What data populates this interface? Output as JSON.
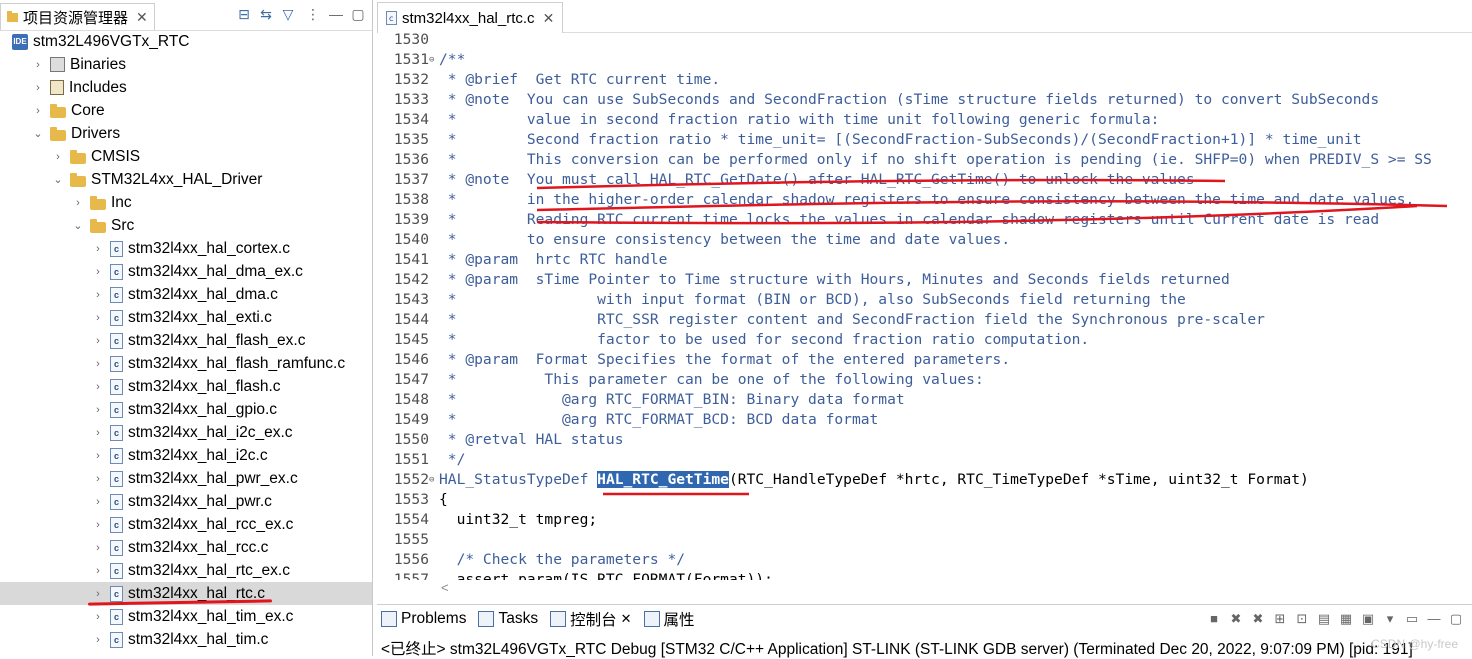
{
  "left_panel": {
    "tab_title": "项目资源管理器",
    "tree": [
      {
        "label": "stm32L496VGTx_RTC",
        "icon": "project-icon",
        "level": 0,
        "chevron": "down"
      },
      {
        "label": "Binaries",
        "icon": "binaries-icon",
        "level": 1,
        "chevron": "right"
      },
      {
        "label": "Includes",
        "icon": "includes-icon",
        "level": 1,
        "chevron": "right"
      },
      {
        "label": "Core",
        "icon": "folder-icon",
        "level": 1,
        "chevron": "right"
      },
      {
        "label": "Drivers",
        "icon": "folder-icon",
        "level": 1,
        "chevron": "down"
      },
      {
        "label": "CMSIS",
        "icon": "folder-icon",
        "level": 2,
        "chevron": "right"
      },
      {
        "label": "STM32L4xx_HAL_Driver",
        "icon": "folder-icon",
        "level": 2,
        "chevron": "down"
      },
      {
        "label": "Inc",
        "icon": "folder-icon",
        "level": 3,
        "chevron": "right"
      },
      {
        "label": "Src",
        "icon": "folder-icon",
        "level": 3,
        "chevron": "down"
      },
      {
        "label": "stm32l4xx_hal_cortex.c",
        "icon": "c-file-icon",
        "level": 4,
        "chevron": "right"
      },
      {
        "label": "stm32l4xx_hal_dma_ex.c",
        "icon": "c-file-icon",
        "level": 4,
        "chevron": "right"
      },
      {
        "label": "stm32l4xx_hal_dma.c",
        "icon": "c-file-icon",
        "level": 4,
        "chevron": "right"
      },
      {
        "label": "stm32l4xx_hal_exti.c",
        "icon": "c-file-icon",
        "level": 4,
        "chevron": "right"
      },
      {
        "label": "stm32l4xx_hal_flash_ex.c",
        "icon": "c-file-icon",
        "level": 4,
        "chevron": "right"
      },
      {
        "label": "stm32l4xx_hal_flash_ramfunc.c",
        "icon": "c-file-icon",
        "level": 4,
        "chevron": "right"
      },
      {
        "label": "stm32l4xx_hal_flash.c",
        "icon": "c-file-icon",
        "level": 4,
        "chevron": "right"
      },
      {
        "label": "stm32l4xx_hal_gpio.c",
        "icon": "c-file-icon",
        "level": 4,
        "chevron": "right"
      },
      {
        "label": "stm32l4xx_hal_i2c_ex.c",
        "icon": "c-file-icon",
        "level": 4,
        "chevron": "right"
      },
      {
        "label": "stm32l4xx_hal_i2c.c",
        "icon": "c-file-icon",
        "level": 4,
        "chevron": "right"
      },
      {
        "label": "stm32l4xx_hal_pwr_ex.c",
        "icon": "c-file-icon",
        "level": 4,
        "chevron": "right"
      },
      {
        "label": "stm32l4xx_hal_pwr.c",
        "icon": "c-file-icon",
        "level": 4,
        "chevron": "right"
      },
      {
        "label": "stm32l4xx_hal_rcc_ex.c",
        "icon": "c-file-icon",
        "level": 4,
        "chevron": "right"
      },
      {
        "label": "stm32l4xx_hal_rcc.c",
        "icon": "c-file-icon",
        "level": 4,
        "chevron": "right"
      },
      {
        "label": "stm32l4xx_hal_rtc_ex.c",
        "icon": "c-file-icon",
        "level": 4,
        "chevron": "right"
      },
      {
        "label": "stm32l4xx_hal_rtc.c",
        "icon": "c-file-icon",
        "level": 4,
        "chevron": "right",
        "selected": true
      },
      {
        "label": "stm32l4xx_hal_tim_ex.c",
        "icon": "c-file-icon",
        "level": 4,
        "chevron": "right"
      },
      {
        "label": "stm32l4xx_hal_tim.c",
        "icon": "c-file-icon",
        "level": 4,
        "chevron": "right"
      }
    ]
  },
  "editor": {
    "tab_title": "stm32l4xx_hal_rtc.c",
    "lines": [
      {
        "n": "1530",
        "t": "",
        "kind": "comment"
      },
      {
        "n": "1531",
        "t": "/**",
        "kind": "comment",
        "fold": true
      },
      {
        "n": "1532",
        "t": " * @brief  Get RTC current time.",
        "kind": "comment"
      },
      {
        "n": "1533",
        "t": " * @note  You can use SubSeconds and SecondFraction (sTime structure fields returned) to convert SubSeconds",
        "kind": "comment"
      },
      {
        "n": "1534",
        "t": " *        value in second fraction ratio with time unit following generic formula:",
        "kind": "comment"
      },
      {
        "n": "1535",
        "t": " *        Second fraction ratio * time_unit= [(SecondFraction-SubSeconds)/(SecondFraction+1)] * time_unit",
        "kind": "comment"
      },
      {
        "n": "1536",
        "t": " *        This conversion can be performed only if no shift operation is pending (ie. SHFP=0) when PREDIV_S >= SS",
        "kind": "comment"
      },
      {
        "n": "1537",
        "t": " * @note  You must call HAL_RTC_GetDate() after HAL_RTC_GetTime() to unlock the values",
        "kind": "comment"
      },
      {
        "n": "1538",
        "t": " *        in the higher-order calendar shadow registers to ensure consistency between the time and date values.",
        "kind": "comment"
      },
      {
        "n": "1539",
        "t": " *        Reading RTC current time locks the values in calendar shadow registers until Current date is read",
        "kind": "comment"
      },
      {
        "n": "1540",
        "t": " *        to ensure consistency between the time and date values.",
        "kind": "comment"
      },
      {
        "n": "1541",
        "t": " * @param  hrtc RTC handle",
        "kind": "comment"
      },
      {
        "n": "1542",
        "t": " * @param  sTime Pointer to Time structure with Hours, Minutes and Seconds fields returned",
        "kind": "comment"
      },
      {
        "n": "1543",
        "t": " *                with input format (BIN or BCD), also SubSeconds field returning the",
        "kind": "comment"
      },
      {
        "n": "1544",
        "t": " *                RTC_SSR register content and SecondFraction field the Synchronous pre-scaler",
        "kind": "comment"
      },
      {
        "n": "1545",
        "t": " *                factor to be used for second fraction ratio computation.",
        "kind": "comment"
      },
      {
        "n": "1546",
        "t": " * @param  Format Specifies the format of the entered parameters.",
        "kind": "comment"
      },
      {
        "n": "1547",
        "t": " *          This parameter can be one of the following values:",
        "kind": "comment"
      },
      {
        "n": "1548",
        "t": " *            @arg RTC_FORMAT_BIN: Binary data format",
        "kind": "comment"
      },
      {
        "n": "1549",
        "t": " *            @arg RTC_FORMAT_BCD: BCD data format",
        "kind": "comment"
      },
      {
        "n": "1550",
        "t": " * @retval HAL status",
        "kind": "comment"
      },
      {
        "n": "1551",
        "t": " */",
        "kind": "comment"
      },
      {
        "n": "1552",
        "t_pre": "HAL_StatusTypeDef ",
        "t_sel": "HAL_RTC_GetTime",
        "t_post": "(RTC_HandleTypeDef *hrtc, RTC_TimeTypeDef *sTime, uint32_t Format)",
        "kind": "signature",
        "fold": true
      },
      {
        "n": "1553",
        "t": "{",
        "kind": "plain"
      },
      {
        "n": "1554",
        "t": "  uint32_t tmpreg;",
        "kind": "plain"
      },
      {
        "n": "1555",
        "t": "",
        "kind": "plain"
      },
      {
        "n": "1556",
        "t": "  /* Check the parameters */",
        "kind": "comment"
      },
      {
        "n": "1557",
        "t": "  assert_param(IS_RTC_FORMAT(Format));",
        "kind": "plain"
      }
    ]
  },
  "bottom_panel": {
    "tabs": [
      {
        "label": "Problems",
        "icon": "problems-icon"
      },
      {
        "label": "Tasks",
        "icon": "tasks-icon"
      },
      {
        "label": "控制台",
        "icon": "console-icon",
        "active": true
      },
      {
        "label": "属性",
        "icon": "properties-icon"
      }
    ],
    "status_text": "<已终止> stm32L496VGTx_RTC Debug [STM32 C/C++ Application] ST-LINK (ST-LINK GDB server) (Terminated Dec 20, 2022, 9:07:09 PM) [pid: 191]",
    "watermark": "CSDN @hy-free"
  },
  "colors": {
    "comment": "#3e5e9a",
    "selection": "#2f67b0",
    "annotation_red": "#e0161f"
  }
}
